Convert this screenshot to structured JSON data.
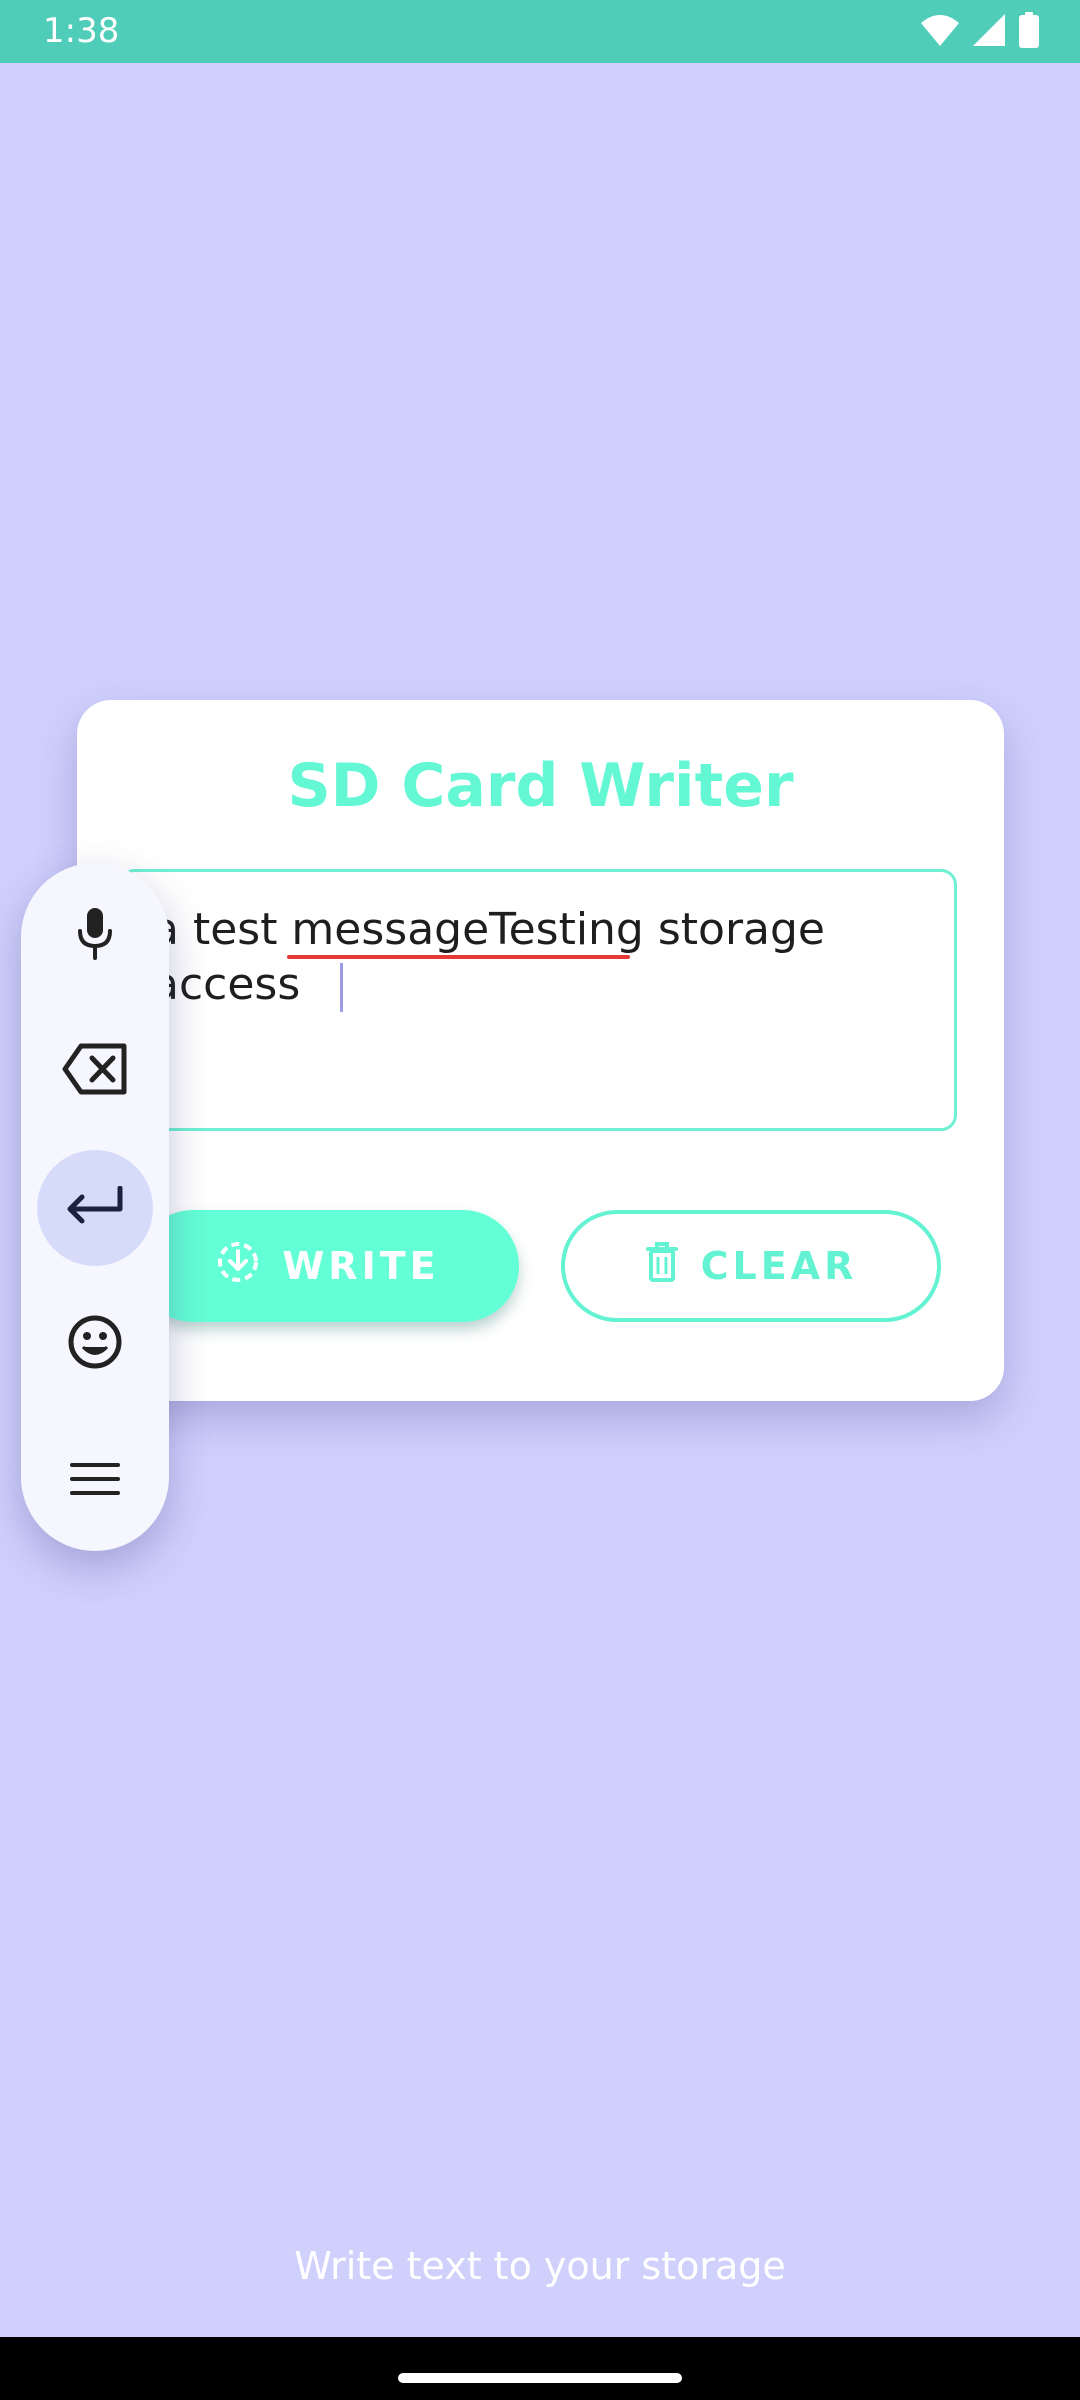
{
  "status_bar": {
    "time": "1:38",
    "icons": [
      "wifi-icon",
      "signal-icon",
      "battery-icon"
    ],
    "background": "#50cdb8"
  },
  "card": {
    "title": "SD Card Writer",
    "title_color": "#64f7d4",
    "text_field": {
      "value": "a test messageTesting storage access",
      "misspelled_word": "messageTesting"
    },
    "buttons": {
      "write_label": "WRITE",
      "write_icon": "download-icon",
      "clear_label": "CLEAR",
      "clear_icon": "trash-icon"
    }
  },
  "keyboard_toolbar": {
    "items": [
      "mic-icon",
      "backspace-icon",
      "enter-icon",
      "emoji-icon",
      "menu-icon"
    ],
    "active_item": "enter-icon"
  },
  "footer": {
    "text": "Write text to your storage"
  },
  "colors": {
    "background": "#d0d0fd",
    "accent": "#63ffd6",
    "card": "#ffffff"
  }
}
